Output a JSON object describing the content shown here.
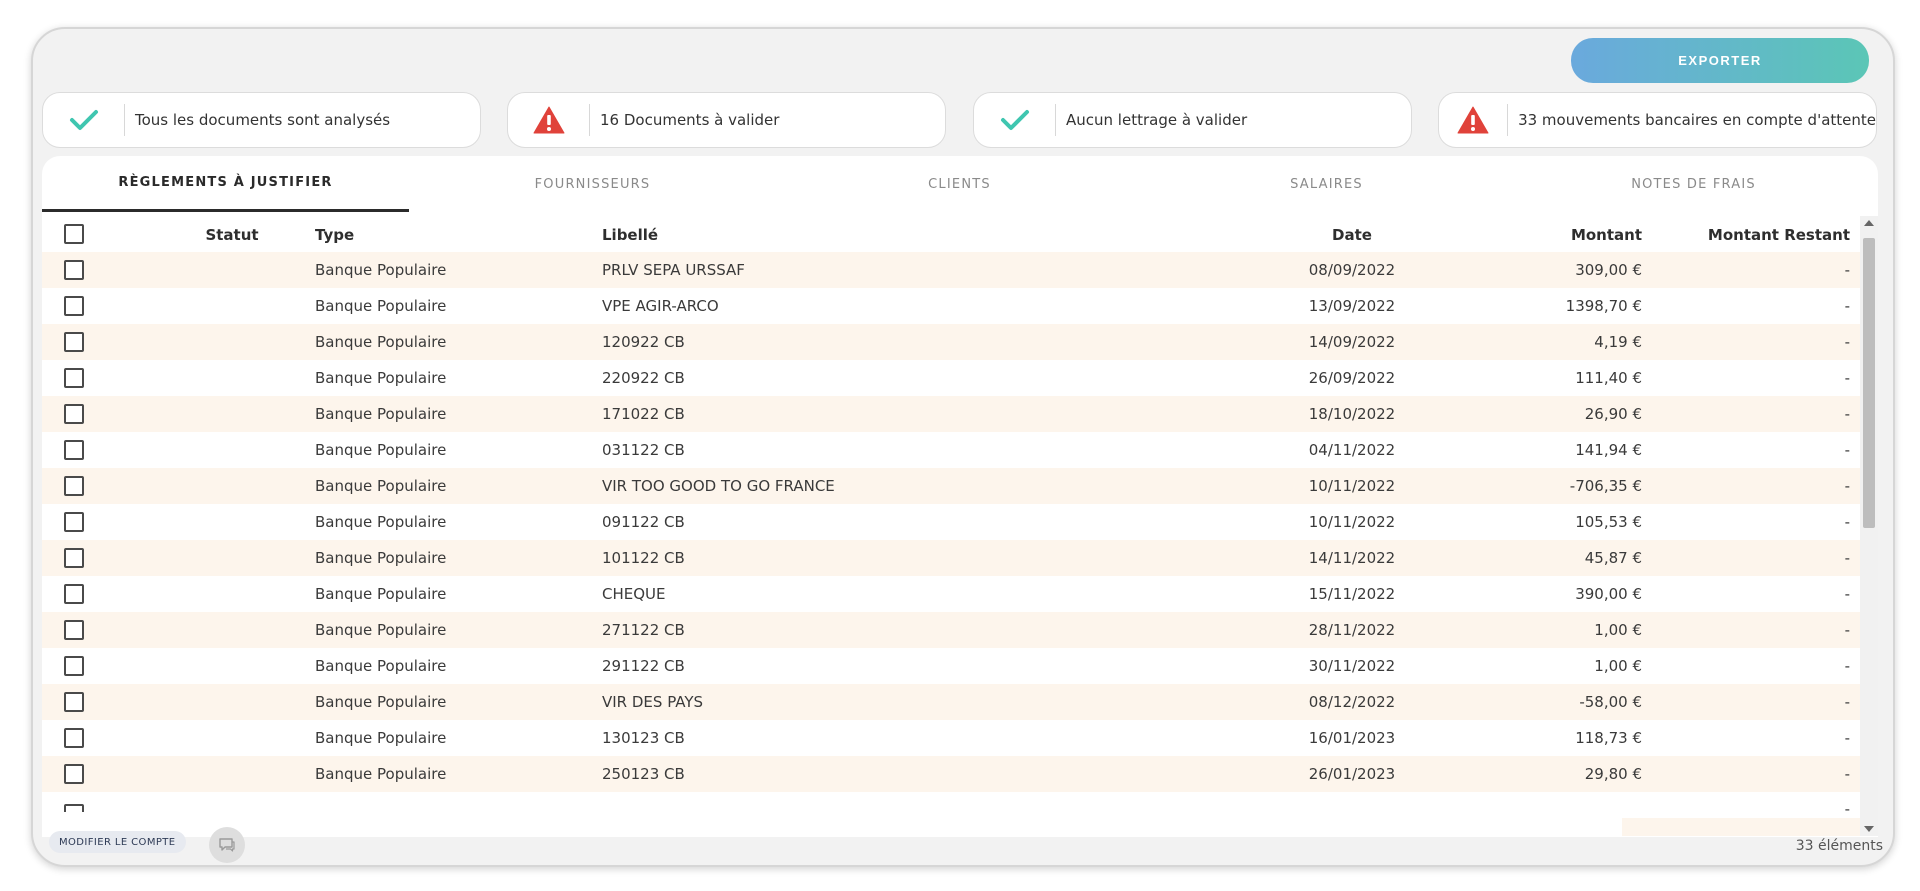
{
  "toolbar": {
    "export_label": "EXPORTER"
  },
  "status_cards": [
    {
      "icon": "check-icon",
      "text": "Tous les documents sont analysés"
    },
    {
      "icon": "warning-icon",
      "text": "16 Documents à valider"
    },
    {
      "icon": "check-icon",
      "text": "Aucun lettrage à valider"
    },
    {
      "icon": "warning-icon",
      "text": "33 mouvements bancaires en compte d'attente"
    }
  ],
  "colors": {
    "check": "#3fc6b0",
    "warning": "#e0423a",
    "accent_start": "#6aa9dd",
    "accent_end": "#5bc6b6",
    "row_alt": "#fdf5ec"
  },
  "tabs": [
    {
      "label": "RÈGLEMENTS À JUSTIFIER",
      "active": true
    },
    {
      "label": "FOURNISSEURS",
      "active": false
    },
    {
      "label": "CLIENTS",
      "active": false
    },
    {
      "label": "SALAIRES",
      "active": false
    },
    {
      "label": "NOTES DE FRAIS",
      "active": false
    }
  ],
  "table": {
    "columns": {
      "statut": "Statut",
      "type": "Type",
      "libelle": "Libellé",
      "date": "Date",
      "montant": "Montant",
      "restant": "Montant Restant"
    },
    "rows": [
      {
        "type": "Banque Populaire",
        "libelle": "PRLV SEPA URSSAF",
        "date": "08/09/2022",
        "montant": "309,00 €",
        "restant": "-"
      },
      {
        "type": "Banque Populaire",
        "libelle": "VPE AGIR-ARCO",
        "date": "13/09/2022",
        "montant": "1398,70 €",
        "restant": "-"
      },
      {
        "type": "Banque Populaire",
        "libelle": "120922 CB",
        "date": "14/09/2022",
        "montant": "4,19 €",
        "restant": "-"
      },
      {
        "type": "Banque Populaire",
        "libelle": "220922 CB",
        "date": "26/09/2022",
        "montant": "111,40 €",
        "restant": "-"
      },
      {
        "type": "Banque Populaire",
        "libelle": "171022 CB",
        "date": "18/10/2022",
        "montant": "26,90 €",
        "restant": "-"
      },
      {
        "type": "Banque Populaire",
        "libelle": "031122 CB",
        "date": "04/11/2022",
        "montant": "141,94 €",
        "restant": "-"
      },
      {
        "type": "Banque Populaire",
        "libelle": "VIR TOO GOOD TO GO FRANCE",
        "date": "10/11/2022",
        "montant": "-706,35 €",
        "restant": "-"
      },
      {
        "type": "Banque Populaire",
        "libelle": "091122 CB",
        "date": "10/11/2022",
        "montant": "105,53 €",
        "restant": "-"
      },
      {
        "type": "Banque Populaire",
        "libelle": "101122 CB",
        "date": "14/11/2022",
        "montant": "45,87 €",
        "restant": "-"
      },
      {
        "type": "Banque Populaire",
        "libelle": "CHEQUE",
        "date": "15/11/2022",
        "montant": "390,00 €",
        "restant": "-"
      },
      {
        "type": "Banque Populaire",
        "libelle": "271122 CB",
        "date": "28/11/2022",
        "montant": "1,00 €",
        "restant": "-"
      },
      {
        "type": "Banque Populaire",
        "libelle": "291122 CB",
        "date": "30/11/2022",
        "montant": "1,00 €",
        "restant": "-"
      },
      {
        "type": "Banque Populaire",
        "libelle": "VIR DES PAYS",
        "date": "08/12/2022",
        "montant": "-58,00 €",
        "restant": "-"
      },
      {
        "type": "Banque Populaire",
        "libelle": "130123 CB",
        "date": "16/01/2023",
        "montant": "118,73 €",
        "restant": "-"
      },
      {
        "type": "Banque Populaire",
        "libelle": "250123 CB",
        "date": "26/01/2023",
        "montant": "29,80 €",
        "restant": "-"
      }
    ],
    "partial_row_restant": "-"
  },
  "footer": {
    "modify_label": "MODIFIER LE COMPTE",
    "count_text": "33 éléments",
    "comment_icon": "comment-icon"
  }
}
